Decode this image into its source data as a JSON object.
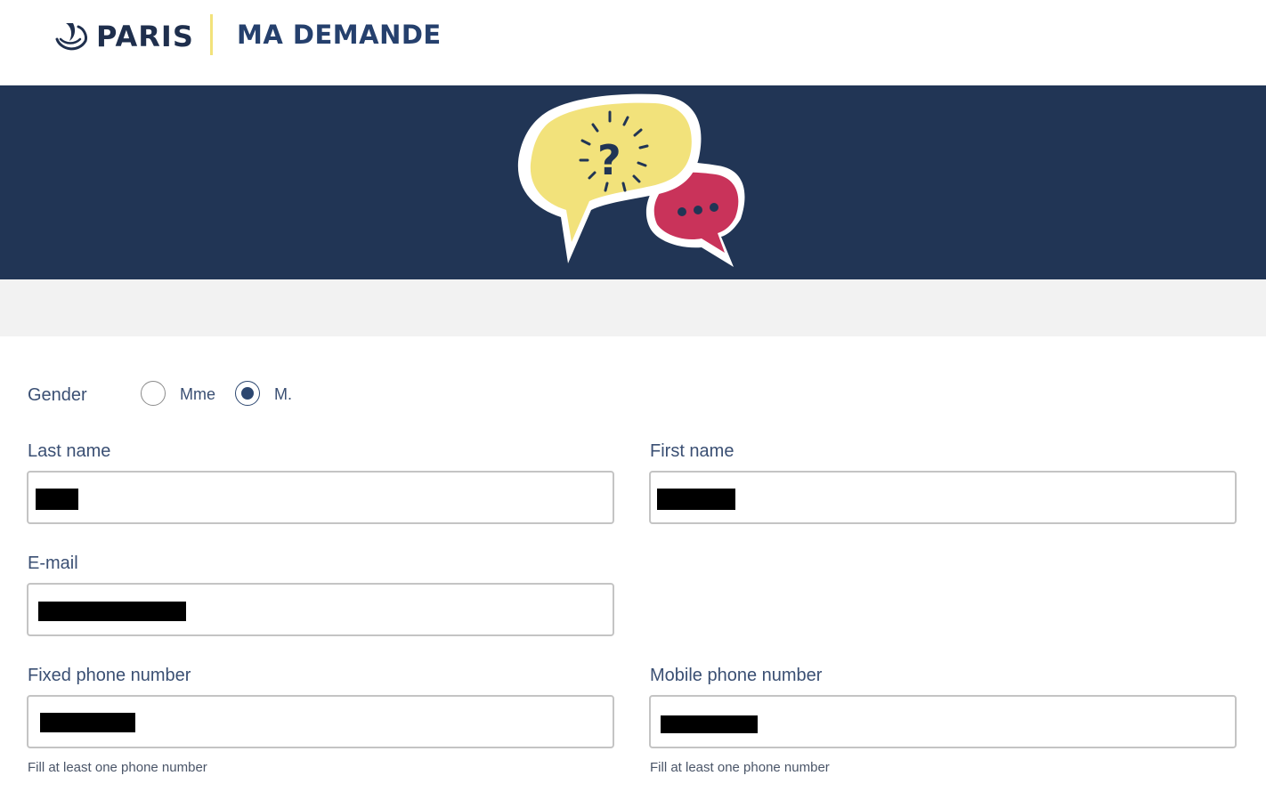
{
  "header": {
    "brand": "PARIS",
    "app_title": "MA DEMANDE"
  },
  "icons": {
    "logo": "paris-ship-logo-icon",
    "banner": "speech-bubbles-question-icon"
  },
  "colors": {
    "navy": "#213555",
    "accent_yellow": "#f2e27b",
    "accent_red": "#c9335a"
  },
  "form": {
    "gender": {
      "label": "Gender",
      "options": [
        {
          "label": "Mme",
          "checked": false
        },
        {
          "label": "M.",
          "checked": true
        }
      ]
    },
    "last_name": {
      "label": "Last name",
      "value": "███"
    },
    "first_name": {
      "label": "First name",
      "value": "██████"
    },
    "email": {
      "label": "E-mail",
      "value": "██████████████"
    },
    "fixed_phone": {
      "label": "Fixed phone number",
      "value": "█████████",
      "hint": "Fill at least one phone number"
    },
    "mobile_phone": {
      "label": "Mobile phone number",
      "value": "█████████",
      "hint": "Fill at least one phone number"
    }
  }
}
